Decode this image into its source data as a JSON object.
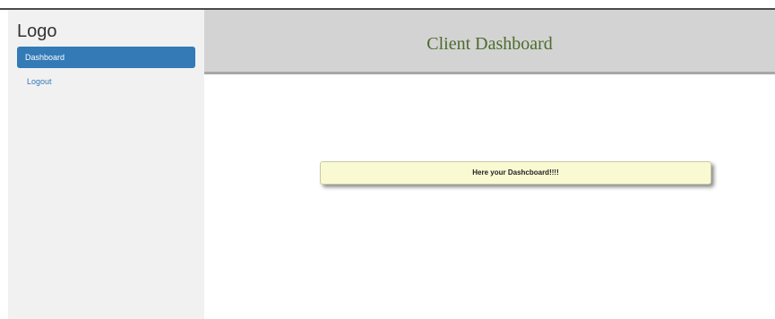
{
  "sidebar": {
    "logo": "Logo",
    "items": [
      {
        "label": "Dashboard",
        "active": true
      },
      {
        "label": "Logout",
        "active": false
      }
    ]
  },
  "header": {
    "title": "Client Dashboard"
  },
  "main": {
    "message": "Here your Dashcboard!!!!"
  },
  "colors": {
    "accent": "#337ab7",
    "header_bg": "#d3d3d3",
    "title_text": "#4d6b2c",
    "notice_bg": "#fafad2",
    "sidebar_bg": "#f1f1f1"
  }
}
